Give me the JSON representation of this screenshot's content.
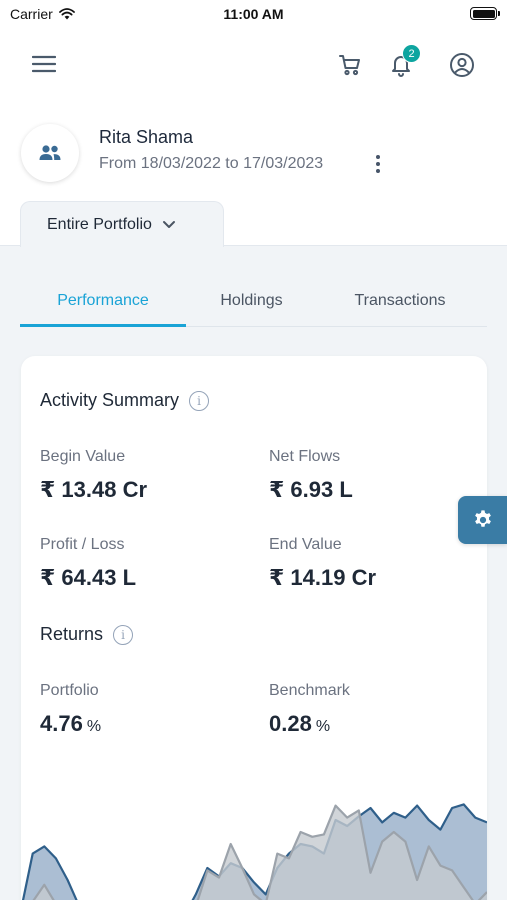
{
  "status_bar": {
    "carrier": "Carrier",
    "time": "11:00 AM"
  },
  "topbar": {
    "notification_count": "2"
  },
  "profile": {
    "client_name": "Rita Shama",
    "date_range": "From 18/03/2022 to 17/03/2023"
  },
  "portfolio_selector": {
    "label": "Entire Portfolio"
  },
  "tabs": [
    {
      "label": "Performance",
      "active": true
    },
    {
      "label": "Holdings",
      "active": false
    },
    {
      "label": "Transactions",
      "active": false
    }
  ],
  "activity_summary": {
    "title": "Activity Summary",
    "begin_value": {
      "label": "Begin Value",
      "value": "₹ 13.48 Cr"
    },
    "net_flows": {
      "label": "Net Flows",
      "value": "₹ 6.93 L"
    },
    "profit_loss": {
      "label": "Profit / Loss",
      "value": "₹ 64.43 L"
    },
    "end_value": {
      "label": "End Value",
      "value": "₹ 14.19 Cr"
    }
  },
  "returns": {
    "title": "Returns",
    "portfolio": {
      "label": "Portfolio",
      "value": "4.76",
      "unit": "%"
    },
    "benchmark": {
      "label": "Benchmark",
      "value": "0.28",
      "unit": "%"
    }
  },
  "chart_data": {
    "type": "area",
    "ylim": [
      0,
      100
    ],
    "x": [
      0,
      1,
      2,
      3,
      4,
      5,
      6,
      7,
      8,
      9,
      10,
      11,
      12,
      13,
      14,
      15,
      16,
      17,
      18,
      19,
      20,
      21,
      22,
      23,
      24,
      25,
      26,
      27,
      28,
      29,
      30,
      31,
      32,
      33,
      34,
      35,
      36,
      37,
      38,
      39,
      40
    ],
    "series": [
      {
        "values": [
          5,
          52,
          58,
          48,
          30,
          8,
          0,
          12,
          0,
          0,
          0,
          0,
          0,
          0,
          0,
          18,
          40,
          33,
          44,
          40,
          28,
          18,
          40,
          52,
          60,
          58,
          52,
          80,
          75,
          83,
          90,
          78,
          86,
          82,
          92,
          80,
          72,
          90,
          93,
          82,
          78
        ],
        "color": "#2f5f8a",
        "fill": "#9cb3cb"
      },
      {
        "values": [
          0,
          12,
          26,
          10,
          0,
          0,
          0,
          0,
          0,
          0,
          0,
          0,
          0,
          0,
          0,
          8,
          38,
          32,
          60,
          40,
          18,
          10,
          52,
          48,
          70,
          66,
          68,
          92,
          82,
          88,
          36,
          62,
          70,
          62,
          30,
          58,
          42,
          38,
          24,
          10,
          20
        ],
        "color": "#9ca3ab",
        "fill": "#c6cacf"
      }
    ]
  },
  "icons": {
    "menu": "hamburger-menu-icon",
    "cart": "cart-icon",
    "bell": "bell-icon",
    "user": "user-circle-icon",
    "avatar": "group-users-icon",
    "settings": "gear-icon"
  },
  "colors": {
    "accent": "#1aa3d6",
    "badge": "#0ea5a0",
    "fab": "#3a7ca5",
    "background_grey": "#f1f4f7"
  }
}
